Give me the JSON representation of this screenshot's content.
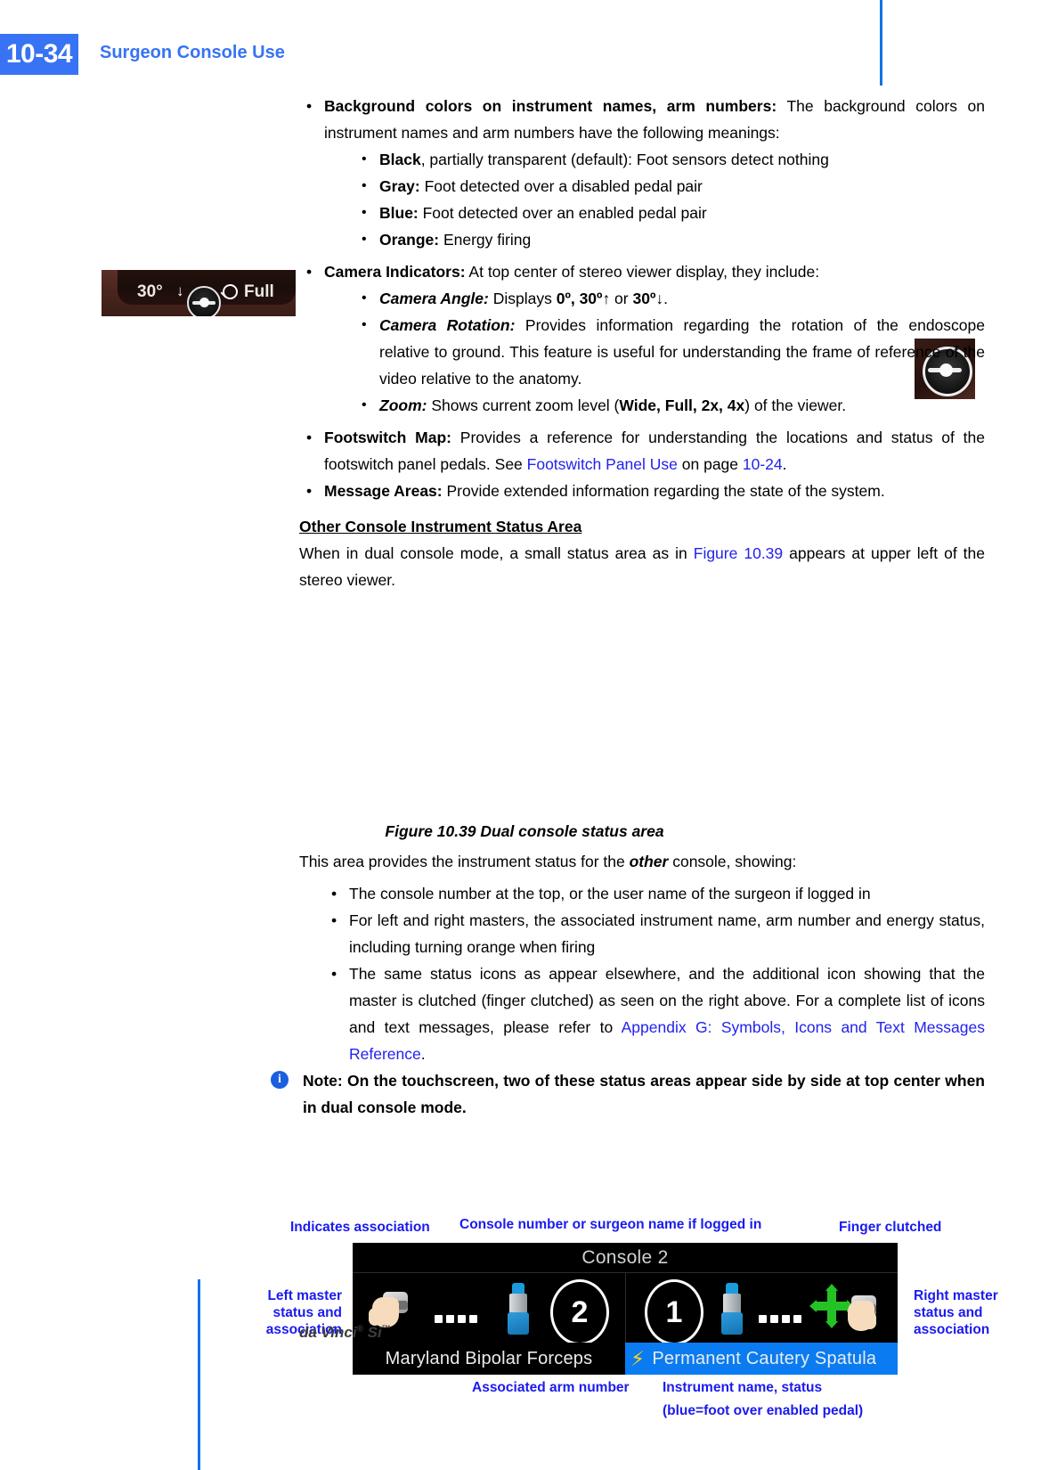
{
  "header": {
    "page_number": "10-34",
    "chapter_title": "Surgeon Console Use"
  },
  "body": {
    "bullet_bg_colors": {
      "lead_bold": "Background colors on instrument names, arm numbers:",
      "lead_rest": " The background colors on instrument names and arm numbers have the following meanings:",
      "sub": [
        {
          "bold": "Black",
          "rest": ", partially transparent (default): Foot sensors detect nothing"
        },
        {
          "bold": "Gray:",
          "rest": " Foot detected over a disabled pedal pair"
        },
        {
          "bold": "Blue:",
          "rest": " Foot detected over an enabled pedal pair"
        },
        {
          "bold": "Orange:",
          "rest": " Energy firing"
        }
      ]
    },
    "bullet_camera": {
      "lead_bold": "Camera Indicators:",
      "lead_rest": " At top center of stereo viewer display, they include:",
      "angle": {
        "bold": "Camera Angle:",
        "pre": " Displays ",
        "v1": "0º, 30º",
        "arrow_up": "↑",
        "mid": " or ",
        "v2": "30º",
        "arrow_down": "↓",
        "post": "."
      },
      "rotation": {
        "bold": "Camera Rotation:",
        "rest": " Provides information regarding the rotation of the endoscope relative to ground. This feature is useful for understanding the frame of reference of the video relative to the anatomy."
      },
      "zoom": {
        "bold": "Zoom:",
        "pre": " Shows current zoom level (",
        "levels": "Wide, Full, 2x, 4x",
        "post": ") of the viewer."
      }
    },
    "bullet_footswitch": {
      "lead_bold": "Footswitch Map:",
      "rest_1": " Provides a reference for understanding the locations and status of the footswitch panel pedals. See ",
      "link_1": "Footswitch Panel Use",
      "rest_2": " on page ",
      "link_2": "10-24",
      "rest_3": "."
    },
    "bullet_message": {
      "lead_bold": "Message Areas:",
      "rest": " Provide extended information regarding the state of the system."
    },
    "subhead": "Other Console Instrument Status Area",
    "subhead_para": {
      "pre": "When in dual console mode, a small status area as in ",
      "link": "Figure 10.39",
      "post": " appears at upper left of the stereo viewer."
    },
    "after_figure_intro": {
      "pre": "This area provides the instrument status for the ",
      "em": "other",
      "post": " console, showing:"
    },
    "after_figure_bullets": [
      {
        "text": "The console number at the top, or the user name of the surgeon if logged in"
      },
      {
        "text": "For left and right masters, the associated instrument name, arm number and energy status, including turning orange when firing"
      },
      {
        "pre": "The same status icons as appear elsewhere, and the additional icon showing that the master is clutched (finger clutched) as seen on the right above. For a complete list of icons and text messages, please refer to ",
        "link": "Appendix G: Symbols, Icons and Text Messages Reference",
        "post": "."
      }
    ],
    "note": {
      "icon": "info-icon",
      "text": "Note: On the touchscreen, two of these status areas appear side by side at top center when in dual console mode."
    }
  },
  "inline_strip": {
    "angle": "30°",
    "arrow": "↓",
    "zoom_level": "Full",
    "dial_icon": "camera-rotation-dial-icon",
    "magnifier_icon": "magnifier-icon"
  },
  "rotation_thumb": {
    "dial_icon": "camera-rotation-dial-icon"
  },
  "figure": {
    "caption": "Figure 10.39 Dual console status area",
    "console": {
      "title": "Console 2",
      "left": {
        "hand_icon": "left-master-hand-icon",
        "dots_icon": "association-dots-icon",
        "instrument_icon": "instrument-icon",
        "arm_number": "2",
        "instrument_name": "Maryland Bipolar Forceps",
        "name_bar_color": "#000000"
      },
      "right": {
        "arm_number": "1",
        "instrument_icon": "instrument-icon",
        "dots_icon": "association-dots-icon",
        "clutch_icon": "finger-clutch-icon",
        "hand_icon": "right-master-hand-icon",
        "energy_icon": "lightning-bolt-icon",
        "instrument_name": "Permanent Cautery Spatula",
        "name_bar_color": "#0a7bf0"
      }
    },
    "callouts": {
      "indicates_association": "Indicates association",
      "console_number": "Console number or surgeon name if logged in",
      "finger_clutched": "Finger clutched",
      "left_master": "Left master\nstatus and\nassociation",
      "left_master_l1": "Left master",
      "left_master_l2": "status and",
      "left_master_l3": "association",
      "right_master_l1": "Right master",
      "right_master_l2": "status and",
      "right_master_l3": "association",
      "associated_arm_number": "Associated arm number",
      "instrument_name_status_l1": "Instrument name, status",
      "instrument_name_status_l2": "(blue=foot over enabled pedal)"
    }
  },
  "footer": {
    "product": "da Vinci",
    "registered": "®",
    "model": " Si",
    "trademark": "™"
  },
  "colors": {
    "accent_blue": "#3773f4",
    "link_blue": "#2222ee",
    "callout_blue": "#1a1af0",
    "leader_cyan": "#00d8ef",
    "status_blue": "#0a7bf0",
    "clutch_green": "#25c225"
  }
}
